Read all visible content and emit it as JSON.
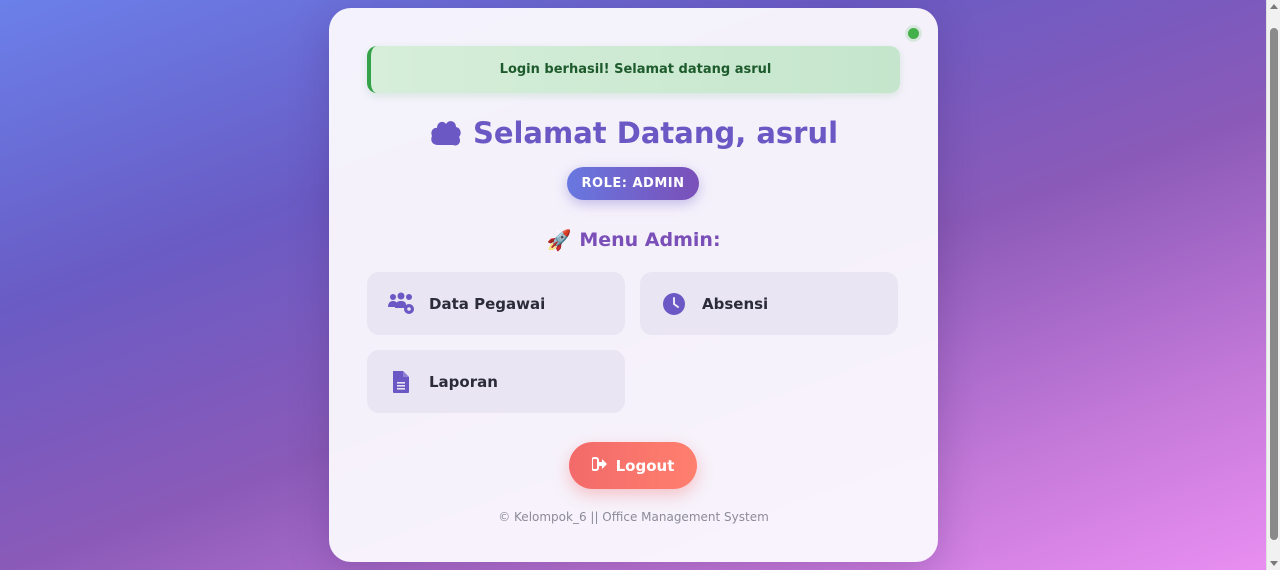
{
  "alert": {
    "message": "Login berhasil! Selamat datang asrul"
  },
  "header": {
    "welcome": "Selamat Datang, asrul",
    "role_badge": "ROLE: ADMIN"
  },
  "menu": {
    "title": "Menu Admin:",
    "items": [
      {
        "label": "Data Pegawai",
        "icon": "users-gear-icon"
      },
      {
        "label": "Absensi",
        "icon": "clock-icon"
      },
      {
        "label": "Laporan",
        "icon": "document-icon"
      }
    ]
  },
  "logout": {
    "label": "Logout",
    "icon": "sign-out-icon"
  },
  "footer": {
    "text": "© Kelompok_6 || Office Management System"
  },
  "colors": {
    "accent": "#6b58c4",
    "status_online": "#43b049",
    "alert_success": "#35a24a",
    "logout": "#f26a6a"
  }
}
